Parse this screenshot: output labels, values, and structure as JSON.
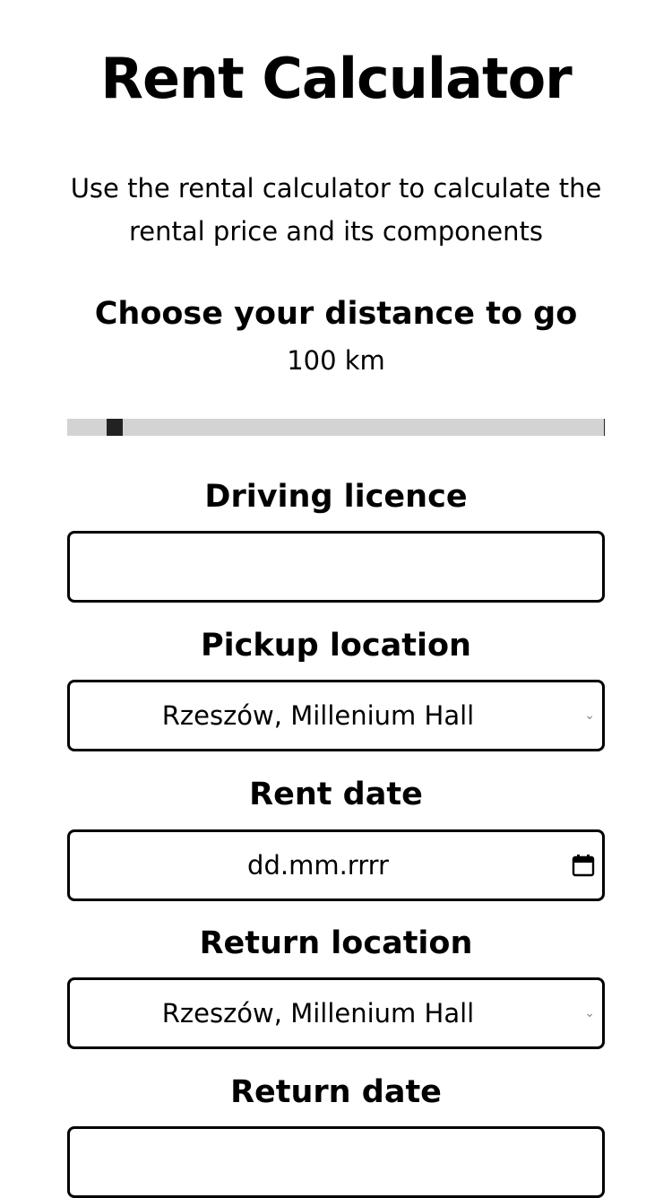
{
  "header": {
    "title": "Rent Calculator",
    "subtitle": "Use the rental calculator to calculate the rental price and its components"
  },
  "distance": {
    "label": "Choose your distance to go",
    "value_text": "100 km",
    "slider_fraction": 0.075
  },
  "licence": {
    "label": "Driving licence",
    "value": ""
  },
  "pickup": {
    "label": "Pickup location",
    "selected": "Rzeszów, Millenium Hall",
    "icon": "chevron-down-icon"
  },
  "rent_date": {
    "label": "Rent date",
    "placeholder": "dd.mm.rrrr",
    "icon": "calendar-icon"
  },
  "return_location": {
    "label": "Return location",
    "selected": "Rzeszów, Millenium Hall",
    "icon": "chevron-down-icon"
  },
  "return_date": {
    "label": "Return date"
  }
}
